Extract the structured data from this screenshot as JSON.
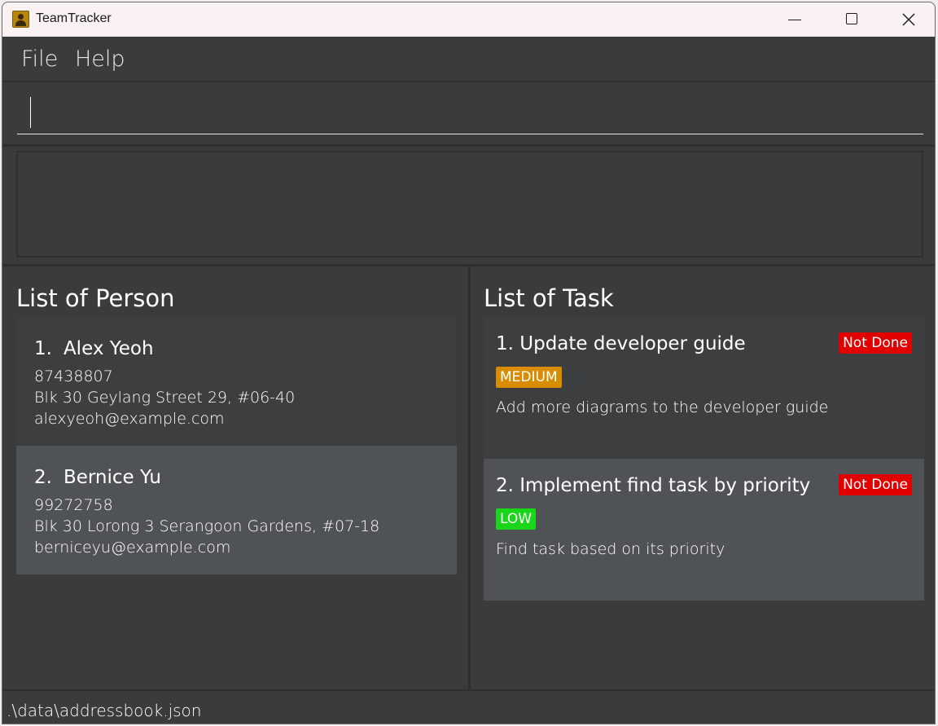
{
  "window": {
    "title": "TeamTracker"
  },
  "menu": {
    "file": "File",
    "help": "Help"
  },
  "command": {
    "value": "",
    "placeholder": ""
  },
  "result": {
    "text": ""
  },
  "persons": {
    "title": "List of Person",
    "items": [
      {
        "index": "1.",
        "name": "Alex Yeoh",
        "phone": "87438807",
        "address": "Blk 30 Geylang Street 29, #06-40",
        "email": "alexyeoh@example.com"
      },
      {
        "index": "2.",
        "name": "Bernice Yu",
        "phone": "99272758",
        "address": "Blk 30 Lorong 3 Serangoon Gardens, #07-18",
        "email": "berniceyu@example.com"
      }
    ]
  },
  "tasks": {
    "title": "List of Task",
    "items": [
      {
        "title": "1. Update developer guide",
        "status": "Not Done",
        "priority": "MEDIUM",
        "description": "Add more diagrams to the developer guide"
      },
      {
        "title": "2. Implement find task by priority",
        "status": "Not Done",
        "priority": "LOW",
        "description": "Find task based on its priority"
      }
    ]
  },
  "statusbar": {
    "path": ".\\data\\addressbook.json"
  },
  "colors": {
    "not_done": "#e00000",
    "medium": "#d98c00",
    "low": "#1ad61a",
    "background": "#3b3b3b"
  }
}
